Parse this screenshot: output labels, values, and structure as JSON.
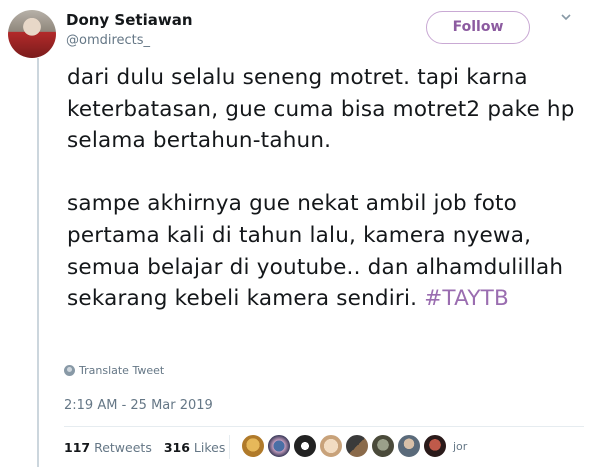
{
  "user": {
    "name": "Dony Setiawan",
    "handle": "@omdirects_"
  },
  "follow_label": "Follow",
  "tweet": {
    "paragraph1": "dari dulu selalu seneng motret. tapi karna keterbatasan, gue cuma bisa motret2 pake hp selama bertahun-tahun.",
    "paragraph2_text": "sampe akhirnya gue nekat ambil job foto pertama kali di tahun lalu, kamera nyewa, semua belajar di youtube.. dan alhamdulillah sekarang kebeli kamera sendiri. ",
    "hashtag": "#TAYTB"
  },
  "translate_label": "Translate Tweet",
  "timestamp": "2:19 AM - 25 Mar 2019",
  "stats": {
    "retweets_count": "117",
    "retweets_label": "Retweets",
    "likes_count": "316",
    "likes_label": "Likes"
  },
  "likers_more": "jor",
  "colors": {
    "accent": "#9a6db0",
    "follow_border": "#c9a9d4",
    "muted": "#657786"
  },
  "icons": {
    "translate": "globe-icon",
    "menu": "chevron-down-icon"
  }
}
